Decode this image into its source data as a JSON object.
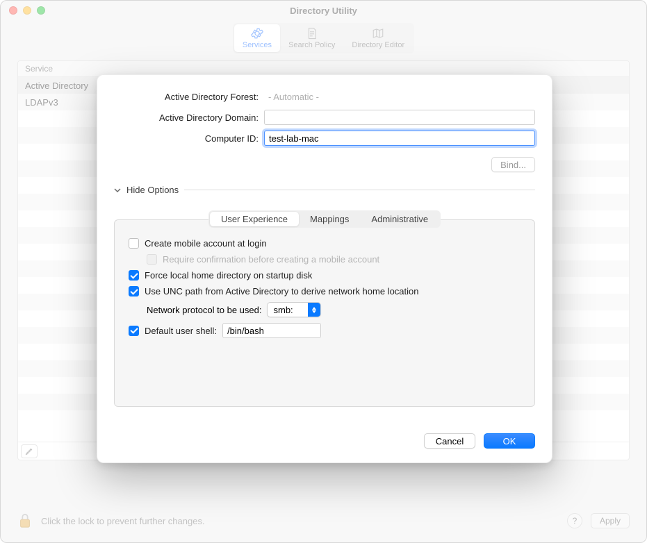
{
  "window": {
    "title": "Directory Utility"
  },
  "toolbar": {
    "tabs": [
      {
        "label": "Services"
      },
      {
        "label": "Search Policy"
      },
      {
        "label": "Directory Editor"
      }
    ]
  },
  "background": {
    "column_header": "Service",
    "rows": [
      "Active Directory",
      "LDAPv3"
    ],
    "lock_text": "Click the lock to prevent further changes.",
    "help_label": "?",
    "apply_label": "Apply"
  },
  "sheet": {
    "forest_label": "Active Directory Forest:",
    "forest_value": "- Automatic -",
    "domain_label": "Active Directory Domain:",
    "domain_value": "",
    "computer_label": "Computer ID:",
    "computer_value": "test-lab-mac",
    "bind_label": "Bind...",
    "toggle_label": "Hide Options",
    "tabs": [
      "User Experience",
      "Mappings",
      "Administrative"
    ],
    "options": {
      "create_mobile": "Create mobile account at login",
      "require_confirm": "Require confirmation before creating a mobile account",
      "force_local": "Force local home directory on startup disk",
      "use_unc": "Use UNC path from Active Directory to derive network home location",
      "protocol_label": "Network protocol to be used:",
      "protocol_value": "smb:",
      "shell_label": "Default user shell:",
      "shell_value": "/bin/bash"
    },
    "cancel_label": "Cancel",
    "ok_label": "OK"
  }
}
